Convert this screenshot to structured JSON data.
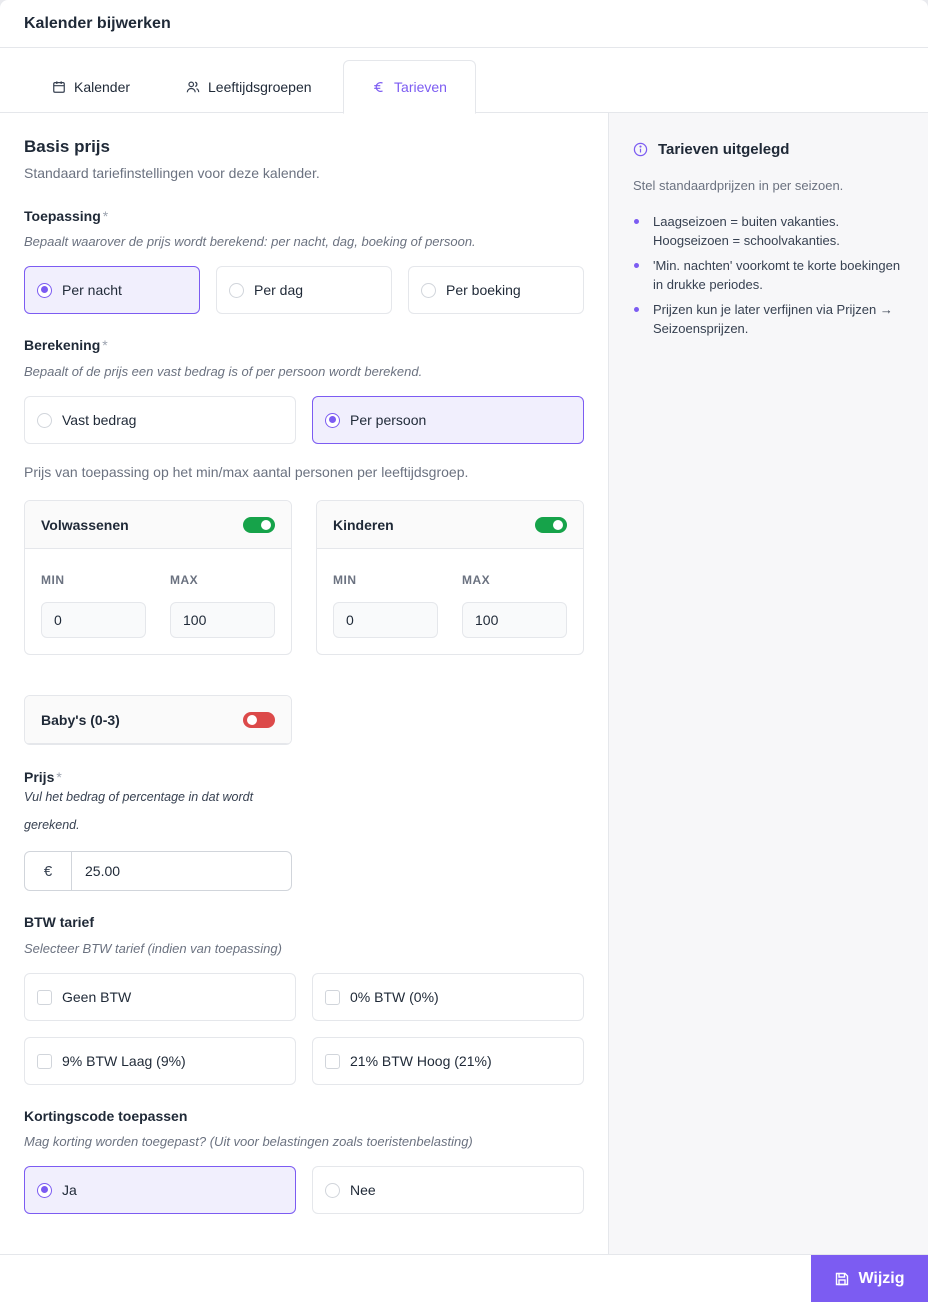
{
  "header": {
    "title": "Kalender bijwerken"
  },
  "tabs": [
    {
      "label": "Kalender",
      "icon": "calendar-icon",
      "active": false
    },
    {
      "label": "Leeftijdsgroepen",
      "icon": "users-icon",
      "active": false
    },
    {
      "label": "Tarieven",
      "icon": "euro-icon",
      "active": true
    }
  ],
  "basis": {
    "title": "Basis prijs",
    "subtitle": "Standaard tariefinstellingen voor deze kalender."
  },
  "toepassing": {
    "label": "Toepassing",
    "required": "*",
    "hint": "Bepaalt waarover de prijs wordt berekend: per nacht, dag, boeking of persoon.",
    "options": [
      {
        "label": "Per nacht",
        "selected": true
      },
      {
        "label": "Per dag",
        "selected": false
      },
      {
        "label": "Per boeking",
        "selected": false
      }
    ]
  },
  "berekening": {
    "label": "Berekening",
    "required": "*",
    "hint": "Bepaalt of de prijs een vast bedrag is of per persoon wordt berekend.",
    "options": [
      {
        "label": "Vast bedrag",
        "selected": false
      },
      {
        "label": "Per persoon",
        "selected": true
      }
    ]
  },
  "groups_note": "Prijs van toepassing op het min/max aantal personen per leeftijdsgroep.",
  "groups": [
    {
      "name": "Volwassenen",
      "enabled": true,
      "min_label": "MIN",
      "max_label": "MAX",
      "min": "0",
      "max": "100"
    },
    {
      "name": "Kinderen",
      "enabled": true,
      "min_label": "MIN",
      "max_label": "MAX",
      "min": "0",
      "max": "100"
    },
    {
      "name": "Baby's (0-3)",
      "enabled": false
    }
  ],
  "prijs": {
    "label": "Prijs",
    "required": "*",
    "hint_line1": "Vul het bedrag of percentage in dat wordt",
    "hint_line2": "gerekend.",
    "currency": "€",
    "value": "25.00"
  },
  "btw": {
    "label": "BTW tarief",
    "hint": "Selecteer BTW tarief (indien van toepassing)",
    "options": [
      {
        "label": "Geen BTW",
        "checked": false
      },
      {
        "label": "0% BTW (0%)",
        "checked": false
      },
      {
        "label": "9% BTW Laag (9%)",
        "checked": false
      },
      {
        "label": "21% BTW Hoog (21%)",
        "checked": false
      }
    ]
  },
  "korting": {
    "label": "Kortingscode toepassen",
    "hint": "Mag korting worden toegepast? (Uit voor belastingen zoals toeristenbelasting)",
    "options": [
      {
        "label": "Ja",
        "selected": true
      },
      {
        "label": "Nee",
        "selected": false
      }
    ]
  },
  "sidebar": {
    "title": "Tarieven uitgelegd",
    "subtitle": "Stel standaardprijzen in per seizoen.",
    "bullets": [
      "Laagseizoen = buiten vakanties. Hoogseizoen = schoolvakanties.",
      "'Min. nachten' voorkomt te korte boekingen in drukke periodes.",
      "Prijzen kun je later verfijnen via Prijzen → Seizoensprijzen."
    ]
  },
  "footer": {
    "save_label": "Wijzig",
    "save_icon": "save-icon"
  },
  "colors": {
    "accent": "#7c5cf2",
    "toggle_on": "#16a34a",
    "toggle_off": "#dc4a4a"
  }
}
